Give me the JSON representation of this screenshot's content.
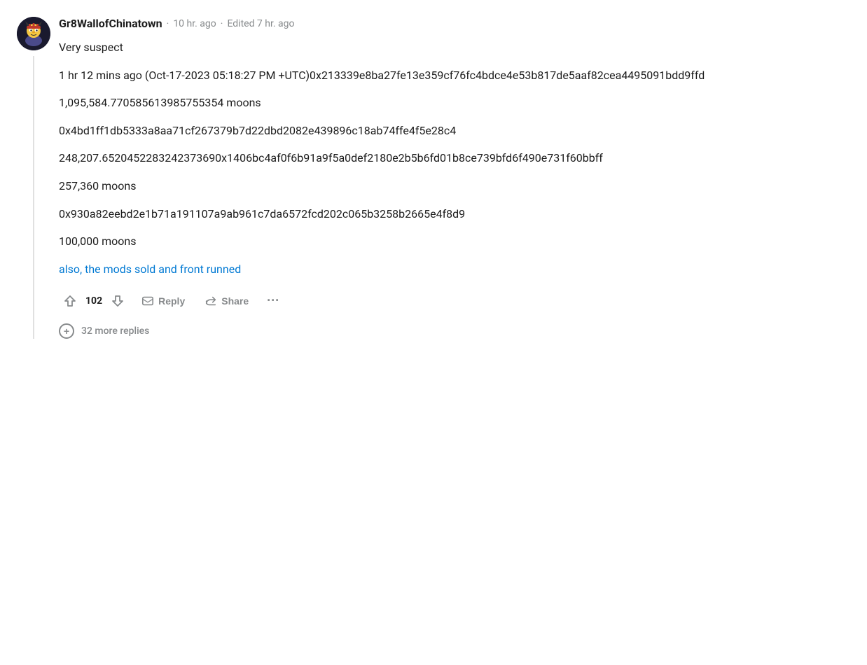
{
  "comment": {
    "username": "Gr8WallofChinatown",
    "timestamp": "10 hr. ago",
    "edited": "Edited 7 hr. ago",
    "body_lines": [
      "Very suspect",
      "1 hr 12 mins ago (Oct-17-2023 05:18:27 PM +UTC)0x213339e8ba27fe13e359cf76fc4bdce4e53b817de5aaf82cea4495091bdd9ffd",
      "1,095,584.770585613985755354 moons",
      "0x4bd1ff1db5333a8aa71cf267379b7d22dbd2082e439896c18ab74ffe4f5e28c4",
      "248,207.6520452283242373690x1406bc4af0f6b91a9f5a0def2180e2b5b6fd01b8ce739bfd6f490e731f60bbff",
      "257,360 moons",
      "0x930a82eebd2e1b71a191107a9ab961c7da6572fcd202c065b3258b2665e4f8d9",
      "100,000 moons",
      "also, the mods sold and front runned"
    ],
    "link_line_index": 8,
    "vote_count": "102",
    "actions": {
      "reply_label": "Reply",
      "share_label": "Share",
      "more_label": "..."
    },
    "more_replies_count": "32 more replies"
  }
}
